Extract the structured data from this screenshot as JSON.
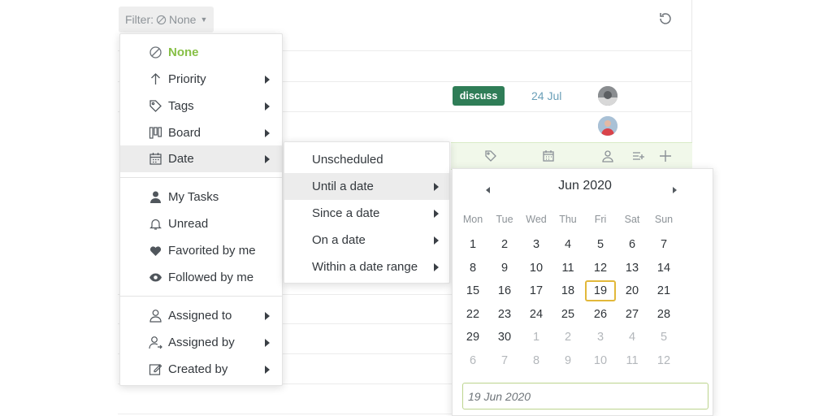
{
  "filter": {
    "label": "Filter:",
    "value": "None"
  },
  "task_row": {
    "badge": "discuss",
    "due": "24 Jul"
  },
  "filter_menu": {
    "groups": [
      [
        {
          "label": "None",
          "icon": "none-icon",
          "submenu": false,
          "highlight": true
        },
        {
          "label": "Priority",
          "icon": "arrow-up-icon",
          "submenu": true
        },
        {
          "label": "Tags",
          "icon": "tag-icon",
          "submenu": true
        },
        {
          "label": "Board",
          "icon": "board-icon",
          "submenu": true
        },
        {
          "label": "Date",
          "icon": "calendar-icon",
          "submenu": true,
          "active": true
        }
      ],
      [
        {
          "label": "My Tasks",
          "icon": "user-icon",
          "submenu": false
        },
        {
          "label": "Unread",
          "icon": "bell-icon",
          "submenu": false
        },
        {
          "label": "Favorited by me",
          "icon": "heart-icon",
          "submenu": false
        },
        {
          "label": "Followed by me",
          "icon": "eye-icon",
          "submenu": false
        }
      ],
      [
        {
          "label": "Assigned to",
          "icon": "user-outline-icon",
          "submenu": true
        },
        {
          "label": "Assigned by",
          "icon": "user-assign-icon",
          "submenu": true
        },
        {
          "label": "Created by",
          "icon": "edit-icon",
          "submenu": true
        }
      ]
    ]
  },
  "date_menu": {
    "items": [
      {
        "label": "Unscheduled",
        "submenu": false
      },
      {
        "label": "Until a date",
        "submenu": true,
        "active": true
      },
      {
        "label": "Since a date",
        "submenu": true
      },
      {
        "label": "On a date",
        "submenu": true
      },
      {
        "label": "Within a date range",
        "submenu": true
      }
    ]
  },
  "calendar": {
    "title": "Jun 2020",
    "weekdays": [
      "Mon",
      "Tue",
      "Wed",
      "Thu",
      "Fri",
      "Sat",
      "Sun"
    ],
    "weeks": [
      [
        "1",
        "2",
        "3",
        "4",
        "5",
        "6",
        "7"
      ],
      [
        "8",
        "9",
        "10",
        "11",
        "12",
        "13",
        "14"
      ],
      [
        "15",
        "16",
        "17",
        "18",
        "19",
        "20",
        "21"
      ],
      [
        "22",
        "23",
        "24",
        "25",
        "26",
        "27",
        "28"
      ],
      [
        "29",
        "30",
        "1",
        "2",
        "3",
        "4",
        "5"
      ],
      [
        "6",
        "7",
        "8",
        "9",
        "10",
        "11",
        "12"
      ]
    ],
    "selected_day": "19",
    "input_value": "19 Jun 2020",
    "colors": {
      "selected_border": "#e2b83a",
      "input_border": "#bcd48d"
    }
  },
  "colors": {
    "accent_green": "#88c047",
    "badge_bg": "#2f7d57",
    "due_date": "#6a9fb8"
  }
}
